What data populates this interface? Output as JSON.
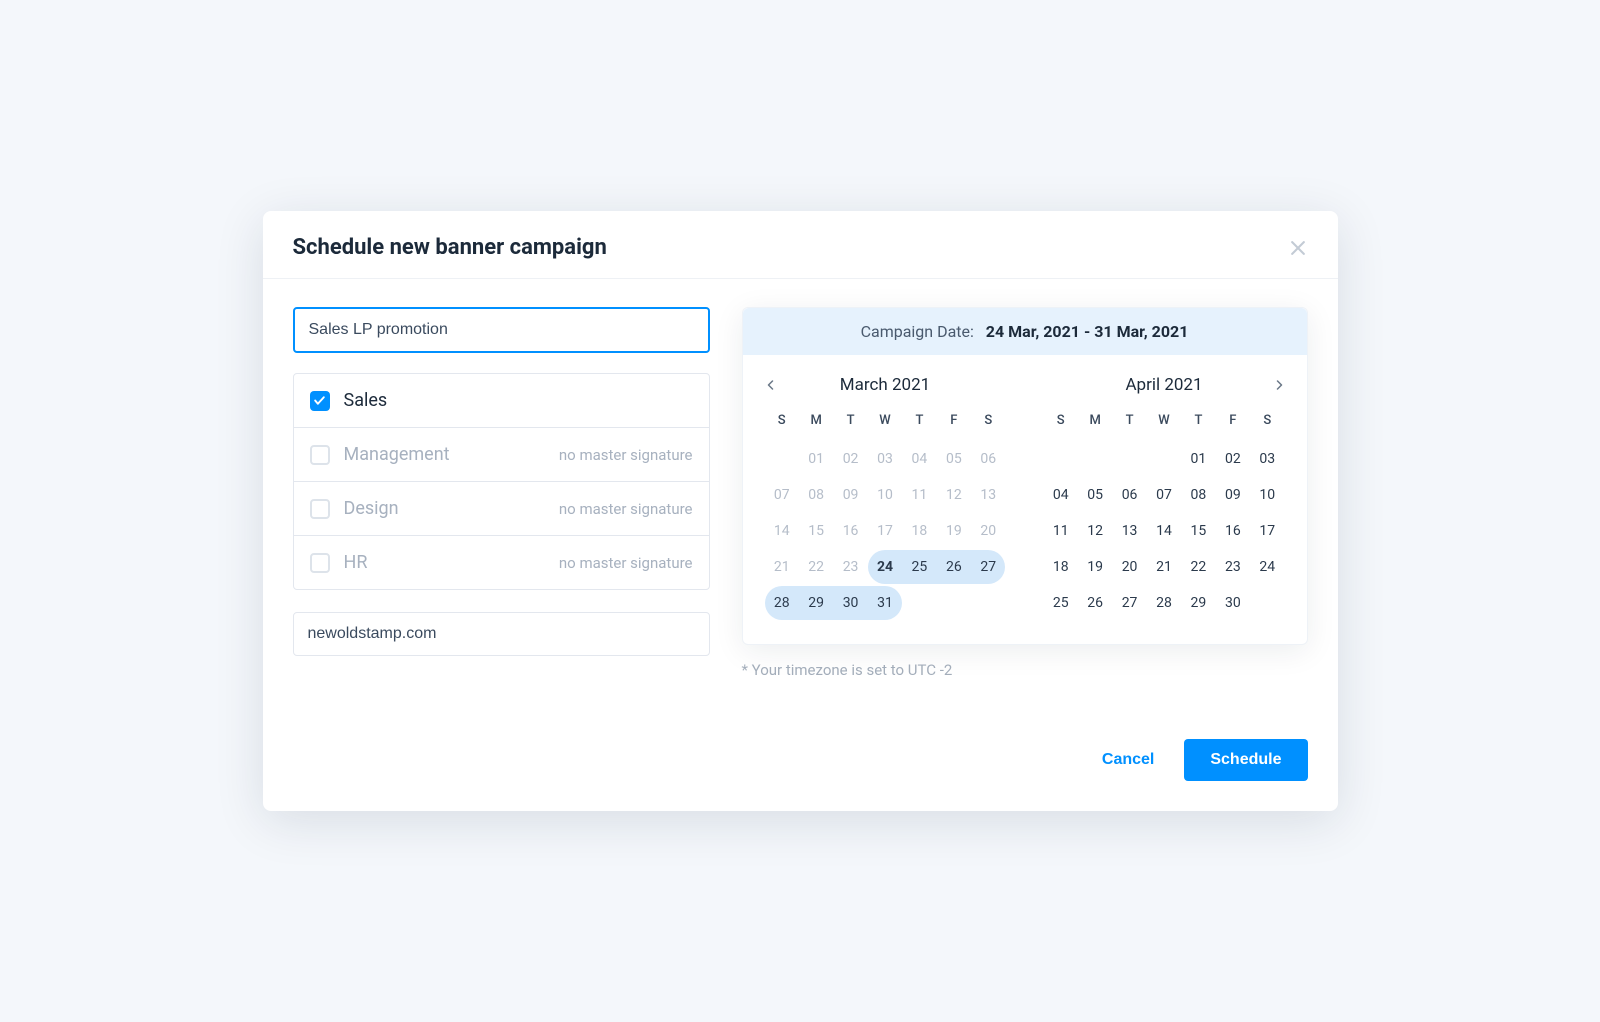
{
  "modal": {
    "title": "Schedule new banner campaign",
    "campaign_name": "Sales LP promotion",
    "url": "newoldstamp.com"
  },
  "departments": [
    {
      "label": "Sales",
      "checked": true,
      "disabled": false,
      "hint": ""
    },
    {
      "label": "Management",
      "checked": false,
      "disabled": true,
      "hint": "no master signature"
    },
    {
      "label": "Design",
      "checked": false,
      "disabled": true,
      "hint": "no master signature"
    },
    {
      "label": "HR",
      "checked": false,
      "disabled": true,
      "hint": "no master signature"
    }
  ],
  "date_range": {
    "label": "Campaign Date:",
    "value": "24 Mar, 2021 - 31 Mar, 2021"
  },
  "timezone_note": "* Your timezone is set to UTC -2",
  "dow": [
    "S",
    "M",
    "T",
    "W",
    "T",
    "F",
    "S"
  ],
  "months": [
    {
      "title": "March 2021",
      "nav": "prev",
      "weeks": [
        [
          null,
          "01",
          "02",
          "03",
          "04",
          "05",
          "06"
        ],
        [
          "07",
          "08",
          "09",
          "10",
          "11",
          "12",
          "13"
        ],
        [
          "14",
          "15",
          "16",
          "17",
          "18",
          "19",
          "20"
        ],
        [
          "21",
          "22",
          "23",
          "24",
          "25",
          "26",
          "27"
        ],
        [
          "28",
          "29",
          "30",
          "31",
          null,
          null,
          null
        ]
      ],
      "muted": [
        "01",
        "02",
        "03",
        "04",
        "05",
        "06",
        "07",
        "08",
        "09",
        "10",
        "11",
        "12",
        "13",
        "14",
        "15",
        "16",
        "17",
        "18",
        "19",
        "20",
        "21",
        "22",
        "23"
      ],
      "range": [
        "24",
        "25",
        "26",
        "27",
        "28",
        "29",
        "30",
        "31"
      ],
      "range_start": "24",
      "range_end": "31"
    },
    {
      "title": "April 2021",
      "nav": "next",
      "weeks": [
        [
          null,
          null,
          null,
          null,
          "01",
          "02",
          "03"
        ],
        [
          "04",
          "05",
          "06",
          "07",
          "08",
          "09",
          "10"
        ],
        [
          "11",
          "12",
          "13",
          "14",
          "15",
          "16",
          "17"
        ],
        [
          "18",
          "19",
          "20",
          "21",
          "22",
          "23",
          "24"
        ],
        [
          "25",
          "26",
          "27",
          "28",
          "29",
          "30",
          null
        ]
      ],
      "muted": [],
      "range": [],
      "range_start": null,
      "range_end": null
    }
  ],
  "footer": {
    "cancel": "Cancel",
    "schedule": "Schedule"
  }
}
